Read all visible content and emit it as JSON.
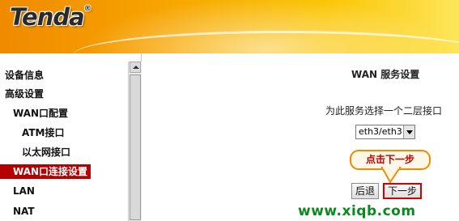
{
  "header": {
    "brand": "Tenda",
    "reg_mark": "®"
  },
  "sidebar": {
    "items": [
      {
        "label": "设备信息",
        "active": false
      },
      {
        "label": "高级设置",
        "active": false
      },
      {
        "label": "WAN口配置",
        "active": false
      },
      {
        "label": "ATM接口",
        "active": false
      },
      {
        "label": "以太网接口",
        "active": false
      },
      {
        "label": "WAN口连接设置",
        "active": true
      },
      {
        "label": "LAN",
        "active": false
      },
      {
        "label": "NAT",
        "active": false
      }
    ]
  },
  "main": {
    "title": "WAN 服务设置",
    "prompt": "为此服务选择一个二层接口",
    "select": {
      "value": "eth3/eth3"
    },
    "callout": "点击下一步",
    "buttons": {
      "back": "后退",
      "next": "下一步"
    }
  },
  "watermark": "www.xiqb.com",
  "colors": {
    "accent": "#f08a00",
    "active_bg": "#b40000",
    "highlight": "#d40000",
    "watermark": "#0a8a1e"
  }
}
